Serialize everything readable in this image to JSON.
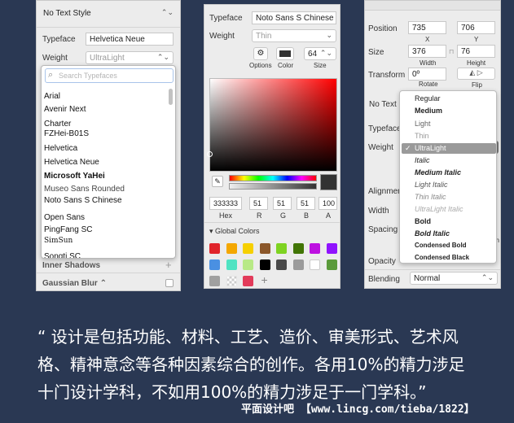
{
  "panel1": {
    "text_style": "No Text Style",
    "typeface_label": "Typeface",
    "typeface_value": "Helvetica Neue",
    "weight_label": "Weight",
    "weight_value": "UltraLight",
    "search_placeholder": "Search Typefaces",
    "fonts": [
      "Arial",
      "Avenir Next",
      "Charter",
      "FZHei-B01S",
      "Helvetica",
      "Helvetica Neue",
      "Microsoft YaHei",
      "Museo Sans Rounded",
      "Noto Sans S Chinese",
      "Open Sans",
      "PingFang SC",
      "SimSun",
      "Songti SC"
    ],
    "inner_shadows": "Inner Shadows",
    "gaussian_blur": "Gaussian Blur"
  },
  "panel2": {
    "typeface_label": "Typeface",
    "typeface_value": "Noto Sans S Chinese",
    "weight_label": "Weight",
    "weight_value": "Thin",
    "options_label": "Options",
    "color_label": "Color",
    "size_label": "Size",
    "size_value": "64",
    "hex_value": "333333",
    "r_value": "51",
    "g_value": "51",
    "b_value": "51",
    "a_value": "100",
    "hex_label": "Hex",
    "r_label": "R",
    "g_label": "G",
    "b_label": "B",
    "a_label": "A",
    "global_colors": "Global Colors",
    "swatch_colors": [
      "#e0242b",
      "#f4a700",
      "#f6d000",
      "#8b572a",
      "#7ed321",
      "#417505",
      "#bd10e0",
      "#9013fe",
      "#4a90e2",
      "#50e3c2",
      "#b8e986",
      "#000000",
      "#4a4a4a",
      "#9b9b9b",
      "#ffffff",
      "#5a9a3a",
      "#a0a0a0",
      "transparent",
      "#e23b5a"
    ],
    "add_symbol": "+"
  },
  "panel3": {
    "position_label": "Position",
    "x_value": "735",
    "y_value": "706",
    "x_label": "X",
    "y_label": "Y",
    "size_label": "Size",
    "width_value": "376",
    "height_value": "76",
    "width_label": "Width",
    "height_label": "Height",
    "transform_label": "Transform",
    "rotate_value": "0º",
    "rotate_label": "Rotate",
    "flip_label": "Flip",
    "text_style_partial": "No Text S",
    "typeface_label": "Typeface",
    "weight_label": "Weight",
    "alignment_label": "Alignment",
    "width2_label": "Width",
    "spacing_label": "Spacing",
    "spacing_partial": "ph",
    "opacity_label": "Opacity",
    "blending_label": "Blending",
    "blending_value": "Normal",
    "weights": [
      "Regular",
      "Medium",
      "Light",
      "Thin",
      "UltraLight",
      "Italic",
      "Medium Italic",
      "Light Italic",
      "Thin Italic",
      "UltraLight Italic",
      "Bold",
      "Bold Italic",
      "Condensed Bold",
      "Condensed Black"
    ],
    "checkmark": "✓"
  },
  "quote": {
    "line1": "“ 设计是包括功能、材料、工艺、造价、审美形式、艺术风",
    "line2": "格、精神意念等各种因素综合的创作。各用10%的精力涉足",
    "line3": "十门设计学科，不如用100%的精力涉足于一门学科。”"
  },
  "footer": "平面设计吧 【www.lincg.com/tieba/1822】"
}
